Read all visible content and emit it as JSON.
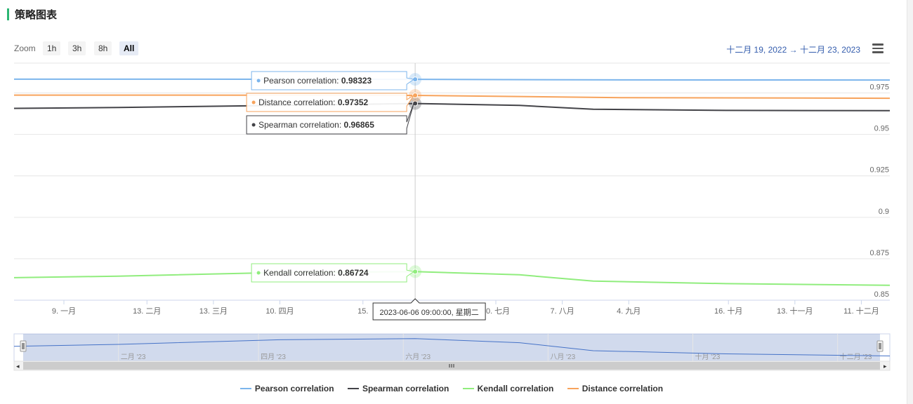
{
  "header": {
    "title": "策略图表"
  },
  "toolbar": {
    "zoom_label": "Zoom",
    "zoom_buttons": [
      "1h",
      "3h",
      "8h",
      "All"
    ],
    "active_zoom": "All",
    "range_from": "十二月 19, 2022",
    "range_arrow": "→",
    "range_to": "十二月 23, 2023"
  },
  "tooltip": {
    "date": "2023-06-06 09:00:00, 星期二",
    "entries": [
      {
        "label": "Pearson correlation",
        "value": "0.98323"
      },
      {
        "label": "Distance correlation",
        "value": "0.97352"
      },
      {
        "label": "Spearman correlation",
        "value": "0.96865"
      },
      {
        "label": "Kendall correlation",
        "value": "0.86724"
      }
    ]
  },
  "chart_data": {
    "type": "line",
    "x_range": [
      "2022-12-19",
      "2023-12-23"
    ],
    "ylim": [
      0.85,
      0.993
    ],
    "y_ticks": [
      0.85,
      0.875,
      0.9,
      0.925,
      0.95,
      0.975
    ],
    "y_tick_labels": [
      "0.85",
      "0.875",
      "0.9",
      "0.925",
      "0.95",
      "0.975"
    ],
    "x_ticks": [
      {
        "date": "2023-01-09",
        "label": "9. 一月"
      },
      {
        "date": "2023-02-13",
        "label": "13. 二月"
      },
      {
        "date": "2023-03-13",
        "label": "13. 三月"
      },
      {
        "date": "2023-04-10",
        "label": "10. 四月"
      },
      {
        "date": "2023-05-15",
        "label": "15."
      },
      {
        "date": "2023-07-10",
        "label": "10. 七月"
      },
      {
        "date": "2023-08-07",
        "label": "7. 八月"
      },
      {
        "date": "2023-09-04",
        "label": "4. 九月"
      },
      {
        "date": "2023-10-16",
        "label": "16. 十月"
      },
      {
        "date": "2023-11-13",
        "label": "13. 十一月"
      },
      {
        "date": "2023-12-11",
        "label": "11. 十二月"
      }
    ],
    "hover_date": "2023-06-06",
    "grid": true,
    "legend_position": "bottom-center",
    "series": [
      {
        "name": "Pearson correlation",
        "color": "#7cb5ec",
        "points": [
          [
            "2022-12-19",
            0.9833
          ],
          [
            "2023-03-01",
            0.9833
          ],
          [
            "2023-06-06",
            0.98323
          ],
          [
            "2023-09-01",
            0.9829
          ],
          [
            "2023-12-23",
            0.9828
          ]
        ]
      },
      {
        "name": "Spearman correlation",
        "color": "#434348",
        "points": [
          [
            "2022-12-19",
            0.9657
          ],
          [
            "2023-02-01",
            0.9662
          ],
          [
            "2023-04-10",
            0.9675
          ],
          [
            "2023-06-06",
            0.96865
          ],
          [
            "2023-07-20",
            0.9675
          ],
          [
            "2023-08-20",
            0.9652
          ],
          [
            "2023-10-15",
            0.9645
          ],
          [
            "2023-12-23",
            0.9643
          ]
        ]
      },
      {
        "name": "Kendall correlation",
        "color": "#90ed7d",
        "points": [
          [
            "2022-12-19",
            0.8636
          ],
          [
            "2023-02-01",
            0.8645
          ],
          [
            "2023-04-10",
            0.8667
          ],
          [
            "2023-06-06",
            0.86724
          ],
          [
            "2023-07-20",
            0.8653
          ],
          [
            "2023-08-20",
            0.8615
          ],
          [
            "2023-10-15",
            0.86
          ],
          [
            "2023-12-23",
            0.859
          ]
        ]
      },
      {
        "name": "Distance correlation",
        "color": "#f7a35c",
        "points": [
          [
            "2022-12-19",
            0.9737
          ],
          [
            "2023-03-01",
            0.9737
          ],
          [
            "2023-06-06",
            0.97352
          ],
          [
            "2023-09-01",
            0.9722
          ],
          [
            "2023-12-23",
            0.9718
          ]
        ]
      }
    ],
    "navigator": {
      "labels": [
        {
          "date": "2023-02-01",
          "label": "二月 '23"
        },
        {
          "date": "2023-04-01",
          "label": "四月 '23"
        },
        {
          "date": "2023-06-01",
          "label": "六月 '23"
        },
        {
          "date": "2023-08-01",
          "label": "八月 '23"
        },
        {
          "date": "2023-10-01",
          "label": "十月 '23"
        },
        {
          "date": "2023-12-01",
          "label": "十二月 '23"
        }
      ]
    }
  },
  "legend": [
    {
      "label": "Pearson correlation",
      "color": "#7cb5ec"
    },
    {
      "label": "Spearman correlation",
      "color": "#434348"
    },
    {
      "label": "Kendall correlation",
      "color": "#90ed7d"
    },
    {
      "label": "Distance correlation",
      "color": "#f7a35c"
    }
  ]
}
